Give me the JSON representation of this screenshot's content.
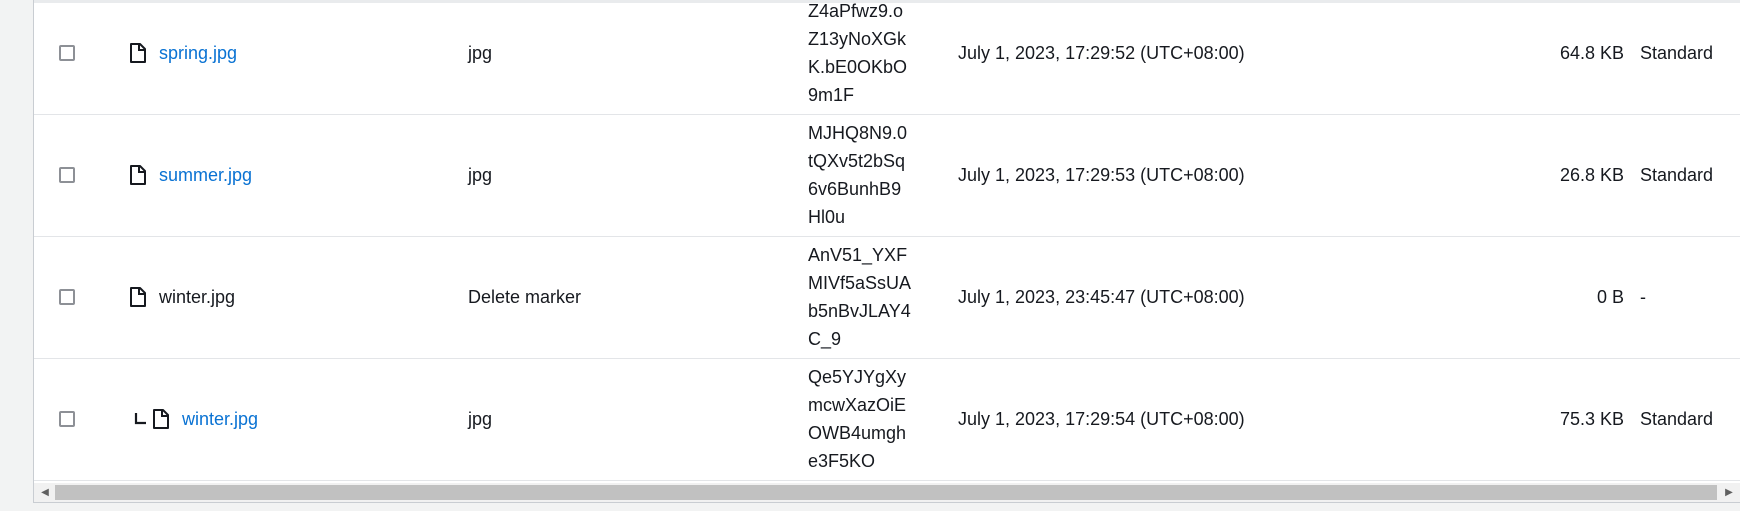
{
  "rows": [
    {
      "name": "spring.jpg",
      "type": "jpg",
      "version_id": [
        "Z4aPfwz9.o",
        "Z13yNoXGk",
        "K.bE0OKbO",
        "9m1F"
      ],
      "last_modified": "July 1, 2023, 17:29:52 (UTC+08:00)",
      "size": "64.8 KB",
      "storage_class": "Standard",
      "is_link": true,
      "is_child": false,
      "icon": "file-icon"
    },
    {
      "name": "summer.jpg",
      "type": "jpg",
      "version_id": [
        "MJHQ8N9.0",
        "tQXv5t2bSq",
        "6v6BunhB9",
        "Hl0u"
      ],
      "last_modified": "July 1, 2023, 17:29:53 (UTC+08:00)",
      "size": "26.8 KB",
      "storage_class": "Standard",
      "is_link": true,
      "is_child": false,
      "icon": "file-icon"
    },
    {
      "name": "winter.jpg",
      "type": "Delete marker",
      "version_id": [
        "AnV51_YXF",
        "MIVf5aSsUA",
        "b5nBvJLAY4",
        "C_9"
      ],
      "last_modified": "July 1, 2023, 23:45:47 (UTC+08:00)",
      "size": "0 B",
      "storage_class": "-",
      "is_link": false,
      "is_child": false,
      "icon": "file-icon"
    },
    {
      "name": "winter.jpg",
      "type": "jpg",
      "version_id": [
        "Qe5YJYgXy",
        "mcwXazOiE",
        "OWB4umgh",
        "e3F5KO"
      ],
      "last_modified": "July 1, 2023, 17:29:54 (UTC+08:00)",
      "size": "75.3 KB",
      "storage_class": "Standard",
      "is_link": true,
      "is_child": true,
      "icon": "file-icon"
    }
  ],
  "scrollbar": {
    "left_arrow": "◀",
    "right_arrow": "▶"
  },
  "colors": {
    "link": "#0972d3",
    "text": "#16191f"
  }
}
